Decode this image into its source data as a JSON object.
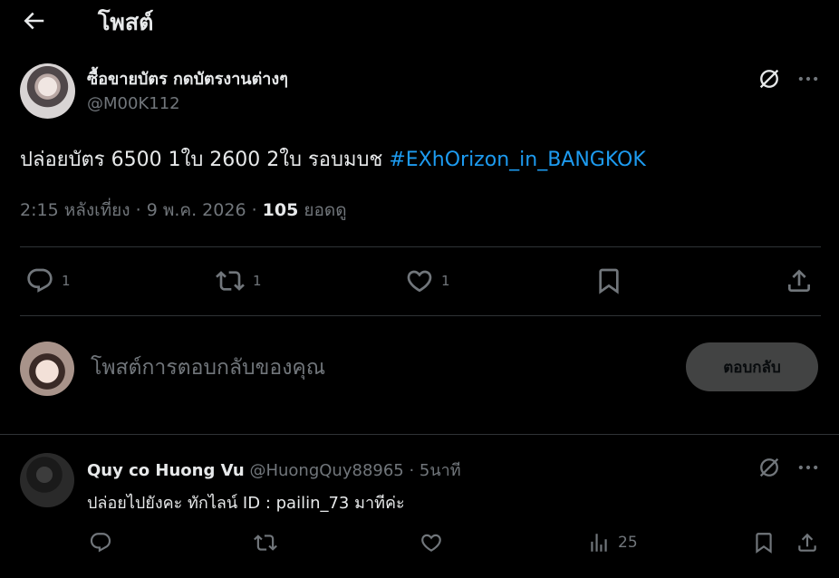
{
  "header": {
    "title": "โพสต์"
  },
  "post": {
    "author_name": "ซื้อขายบัตร กดบัตรงานต่างๆ",
    "author_handle": "@M00K112",
    "text": "ปล่อยบัตร 6500 1ใบ 2600 2ใบ รอบมบช ",
    "hashtag": "#EXhOrizon_in_BANGKOK",
    "time": "2:15 หลังเที่ยง · 9 พ.ค. 2026 · ",
    "views": "105",
    "views_label": " ยอดดู",
    "replies": "1",
    "reposts": "1",
    "likes": "1"
  },
  "compose": {
    "placeholder": "โพสต์การตอบกลับของคุณ",
    "reply_button": "ตอบกลับ"
  },
  "reply": {
    "name": "Quy co Huong Vu",
    "handle": "@HuongQuy88965",
    "separator": " · ",
    "time": "5นาที",
    "text": "ปล่อยไปยังคะ ทักไลน์ ID : pailin_73 มาทีค่ะ",
    "views": "25"
  },
  "colors": {
    "background": "#000000",
    "text": "#e7e9ea",
    "muted": "#71767b",
    "link": "#1d9bf0",
    "divider": "#2f3336"
  },
  "icons": [
    "back-arrow-icon",
    "grok-icon",
    "more-icon",
    "reply-icon",
    "repost-icon",
    "like-icon",
    "bookmark-icon",
    "share-icon",
    "views-icon"
  ]
}
